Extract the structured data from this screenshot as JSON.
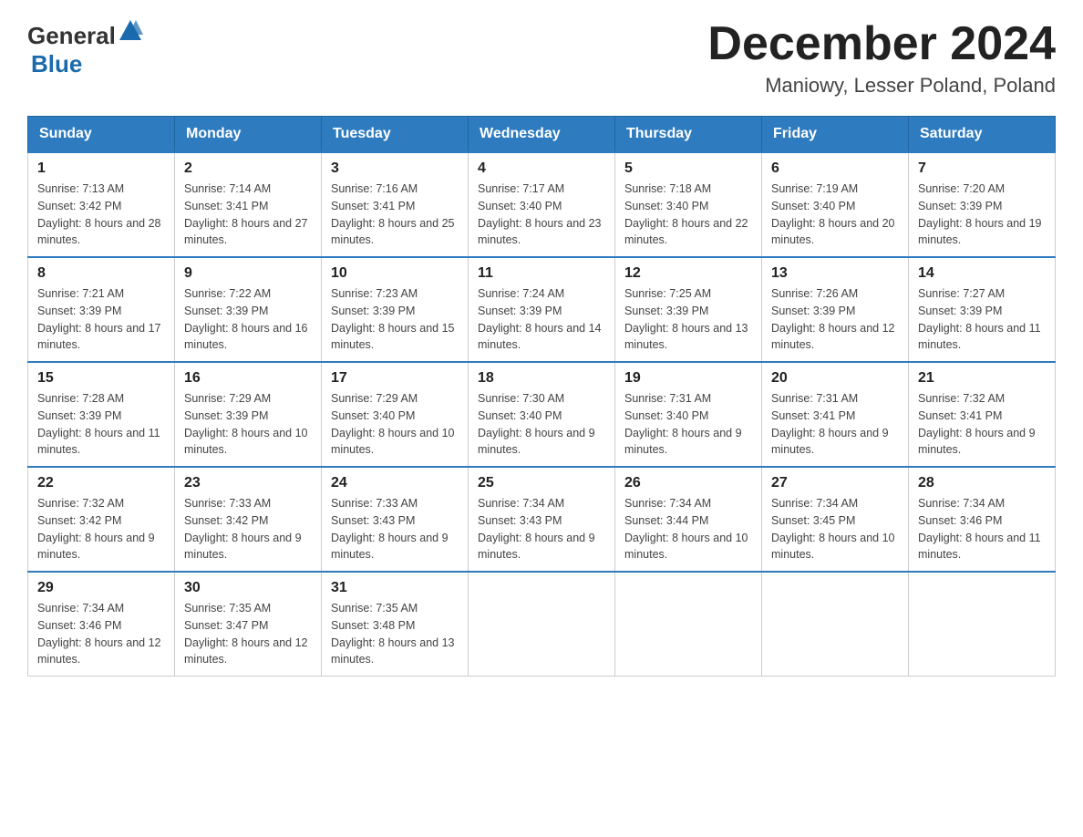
{
  "logo": {
    "text_general": "General",
    "text_blue": "Blue"
  },
  "title": "December 2024",
  "location": "Maniowy, Lesser Poland, Poland",
  "days_of_week": [
    "Sunday",
    "Monday",
    "Tuesday",
    "Wednesday",
    "Thursday",
    "Friday",
    "Saturday"
  ],
  "weeks": [
    [
      {
        "day": "1",
        "sunrise": "7:13 AM",
        "sunset": "3:42 PM",
        "daylight": "8 hours and 28 minutes."
      },
      {
        "day": "2",
        "sunrise": "7:14 AM",
        "sunset": "3:41 PM",
        "daylight": "8 hours and 27 minutes."
      },
      {
        "day": "3",
        "sunrise": "7:16 AM",
        "sunset": "3:41 PM",
        "daylight": "8 hours and 25 minutes."
      },
      {
        "day": "4",
        "sunrise": "7:17 AM",
        "sunset": "3:40 PM",
        "daylight": "8 hours and 23 minutes."
      },
      {
        "day": "5",
        "sunrise": "7:18 AM",
        "sunset": "3:40 PM",
        "daylight": "8 hours and 22 minutes."
      },
      {
        "day": "6",
        "sunrise": "7:19 AM",
        "sunset": "3:40 PM",
        "daylight": "8 hours and 20 minutes."
      },
      {
        "day": "7",
        "sunrise": "7:20 AM",
        "sunset": "3:39 PM",
        "daylight": "8 hours and 19 minutes."
      }
    ],
    [
      {
        "day": "8",
        "sunrise": "7:21 AM",
        "sunset": "3:39 PM",
        "daylight": "8 hours and 17 minutes."
      },
      {
        "day": "9",
        "sunrise": "7:22 AM",
        "sunset": "3:39 PM",
        "daylight": "8 hours and 16 minutes."
      },
      {
        "day": "10",
        "sunrise": "7:23 AM",
        "sunset": "3:39 PM",
        "daylight": "8 hours and 15 minutes."
      },
      {
        "day": "11",
        "sunrise": "7:24 AM",
        "sunset": "3:39 PM",
        "daylight": "8 hours and 14 minutes."
      },
      {
        "day": "12",
        "sunrise": "7:25 AM",
        "sunset": "3:39 PM",
        "daylight": "8 hours and 13 minutes."
      },
      {
        "day": "13",
        "sunrise": "7:26 AM",
        "sunset": "3:39 PM",
        "daylight": "8 hours and 12 minutes."
      },
      {
        "day": "14",
        "sunrise": "7:27 AM",
        "sunset": "3:39 PM",
        "daylight": "8 hours and 11 minutes."
      }
    ],
    [
      {
        "day": "15",
        "sunrise": "7:28 AM",
        "sunset": "3:39 PM",
        "daylight": "8 hours and 11 minutes."
      },
      {
        "day": "16",
        "sunrise": "7:29 AM",
        "sunset": "3:39 PM",
        "daylight": "8 hours and 10 minutes."
      },
      {
        "day": "17",
        "sunrise": "7:29 AM",
        "sunset": "3:40 PM",
        "daylight": "8 hours and 10 minutes."
      },
      {
        "day": "18",
        "sunrise": "7:30 AM",
        "sunset": "3:40 PM",
        "daylight": "8 hours and 9 minutes."
      },
      {
        "day": "19",
        "sunrise": "7:31 AM",
        "sunset": "3:40 PM",
        "daylight": "8 hours and 9 minutes."
      },
      {
        "day": "20",
        "sunrise": "7:31 AM",
        "sunset": "3:41 PM",
        "daylight": "8 hours and 9 minutes."
      },
      {
        "day": "21",
        "sunrise": "7:32 AM",
        "sunset": "3:41 PM",
        "daylight": "8 hours and 9 minutes."
      }
    ],
    [
      {
        "day": "22",
        "sunrise": "7:32 AM",
        "sunset": "3:42 PM",
        "daylight": "8 hours and 9 minutes."
      },
      {
        "day": "23",
        "sunrise": "7:33 AM",
        "sunset": "3:42 PM",
        "daylight": "8 hours and 9 minutes."
      },
      {
        "day": "24",
        "sunrise": "7:33 AM",
        "sunset": "3:43 PM",
        "daylight": "8 hours and 9 minutes."
      },
      {
        "day": "25",
        "sunrise": "7:34 AM",
        "sunset": "3:43 PM",
        "daylight": "8 hours and 9 minutes."
      },
      {
        "day": "26",
        "sunrise": "7:34 AM",
        "sunset": "3:44 PM",
        "daylight": "8 hours and 10 minutes."
      },
      {
        "day": "27",
        "sunrise": "7:34 AM",
        "sunset": "3:45 PM",
        "daylight": "8 hours and 10 minutes."
      },
      {
        "day": "28",
        "sunrise": "7:34 AM",
        "sunset": "3:46 PM",
        "daylight": "8 hours and 11 minutes."
      }
    ],
    [
      {
        "day": "29",
        "sunrise": "7:34 AM",
        "sunset": "3:46 PM",
        "daylight": "8 hours and 12 minutes."
      },
      {
        "day": "30",
        "sunrise": "7:35 AM",
        "sunset": "3:47 PM",
        "daylight": "8 hours and 12 minutes."
      },
      {
        "day": "31",
        "sunrise": "7:35 AM",
        "sunset": "3:48 PM",
        "daylight": "8 hours and 13 minutes."
      },
      null,
      null,
      null,
      null
    ]
  ]
}
